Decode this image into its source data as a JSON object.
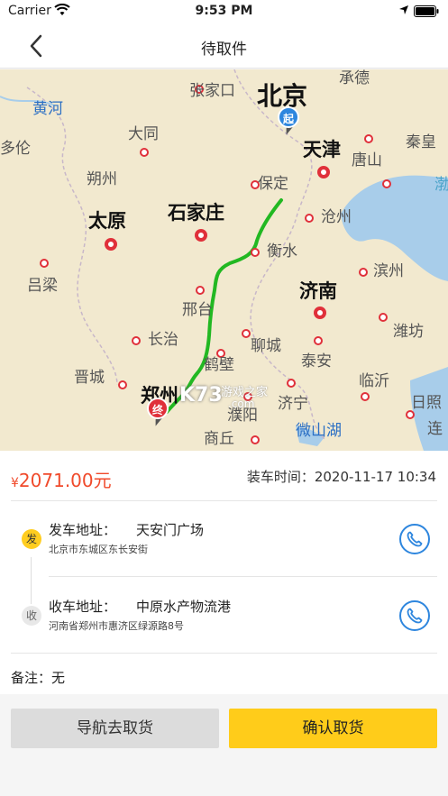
{
  "status_bar": {
    "carrier": "Carrier",
    "time": "9:53 PM"
  },
  "nav": {
    "title": "待取件"
  },
  "map": {
    "cities": {
      "huanghe": "黄河",
      "zhangjiakou": "张家口",
      "beijing": "北京",
      "chengde": "承德",
      "duolun": "多伦",
      "datong": "大同",
      "tianjin": "天津",
      "qinhuang": "秦皇",
      "tangshan": "唐山",
      "shuozhou": "朔州",
      "baoding": "保定",
      "bo": "渤",
      "taiyuan": "太原",
      "shijiazhuang": "石家庄",
      "cangzhou": "沧州",
      "hengshui": "衡水",
      "binzhou": "滨州",
      "lvliang": "吕梁",
      "jinan": "济南",
      "xingtai": "邢台",
      "weifang": "潍坊",
      "changzhi": "长治",
      "liaocheng": "聊城",
      "jincheng": "晋城",
      "hebi": "鹤壁",
      "taian": "泰安",
      "linyi": "临沂",
      "zhengzhou": "郑州",
      "puyang": "濮阳",
      "jining": "济宁",
      "rizhao": "日照",
      "weishanhu": "微山湖",
      "shangqiu": "商丘",
      "lian": "连"
    },
    "pin_start": "起",
    "pin_end": "终",
    "watermark_logo": "K73",
    "watermark_text": "游戏之家",
    "watermark_url": ".com"
  },
  "order": {
    "price_symbol": "¥",
    "price_value": "2071.00元",
    "load_time_label": "装车时间：",
    "load_time_value": "2020-11-17 10:34",
    "send": {
      "badge": "发",
      "label": "发车地址：",
      "name": "天安门广场",
      "detail": "北京市东城区东长安街"
    },
    "recv": {
      "badge": "收",
      "label": "收车地址：",
      "name": "中原水产物流港",
      "detail": "河南省郑州市惠济区绿源路8号"
    },
    "note_label": "备注：",
    "note_value": "无"
  },
  "buttons": {
    "navigate": "导航去取货",
    "confirm": "确认取货"
  },
  "colors": {
    "accent": "#ffcc1a",
    "price": "#f04a2b",
    "phone": "#2e86de",
    "route": "#22b822"
  },
  "icons": [
    "wifi-icon",
    "location-arrow-icon",
    "battery-icon",
    "back-chevron-icon",
    "phone-icon"
  ]
}
